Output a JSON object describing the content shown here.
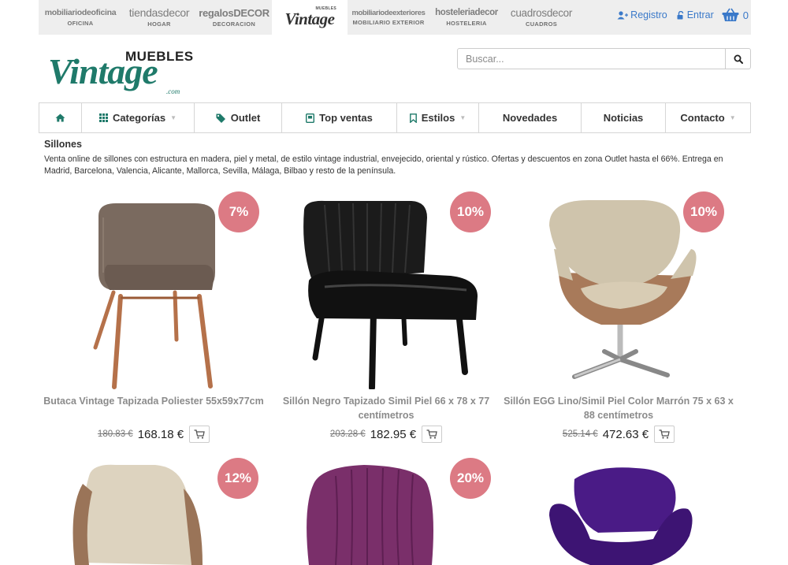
{
  "sites": [
    {
      "name": "mobiliariodeoficina",
      "sub": "OFICINA"
    },
    {
      "name": "tiendasdecor",
      "sub": "HOGAR"
    },
    {
      "name": "regalosDECOR",
      "sub": "DECORACION"
    },
    {
      "name": "Vintage",
      "sub": "MUEBLES",
      "active": true
    },
    {
      "name": "mobiliariodeexteriores",
      "sub": "MOBILIARIO EXTERIOR"
    },
    {
      "name": "hosteleriadecor",
      "sub": "HOSTELERIA"
    },
    {
      "name": "cuadrosdecor",
      "sub": "CUADROS"
    }
  ],
  "account": {
    "register": "Registro",
    "login": "Entrar",
    "cart_count": "0"
  },
  "logo": {
    "muebles": "MUEBLES",
    "vintage": "Vintage",
    "com": ".com"
  },
  "search": {
    "placeholder": "Buscar..."
  },
  "nav": {
    "home_icon": "home-icon",
    "items": [
      {
        "label": "Categorías",
        "icon": "grid-icon",
        "dropdown": true
      },
      {
        "label": "Outlet",
        "icon": "tag-icon",
        "dropdown": false
      },
      {
        "label": "Top ventas",
        "icon": "award-icon",
        "dropdown": false
      },
      {
        "label": "Estilos",
        "icon": "bookmark-icon",
        "dropdown": true
      },
      {
        "label": "Novedades",
        "dropdown": false
      },
      {
        "label": "Noticias",
        "dropdown": false
      },
      {
        "label": "Contacto",
        "dropdown": true
      }
    ]
  },
  "category": {
    "title": "Sillones",
    "description": "Venta online de sillones con estructura en madera, piel y metal, de estilo vintage industrial, envejecido, oriental y rústico. Ofertas y descuentos en zona Outlet hasta el 66%. Entrega en Madrid, Barcelona, Valencia, Alicante, Mallorca, Sevilla, Málaga, Bilbao y resto de la península."
  },
  "products": [
    {
      "name": "Butaca Vintage Tapizada Poliester 55x59x77cm",
      "old_price": "180.83 €",
      "price": "168.18 €",
      "discount": "7%"
    },
    {
      "name": "Sillón Negro Tapizado Simil Piel 66 x 78 x 77 centímetros",
      "old_price": "203.28 €",
      "price": "182.95 €",
      "discount": "10%"
    },
    {
      "name": "Sillón EGG Lino/Simil Piel Color Marrón 75 x 63 x 88 centímetros",
      "old_price": "525.14 €",
      "price": "472.63 €",
      "discount": "10%"
    },
    {
      "name": "",
      "old_price": "",
      "price": "",
      "discount": "12%"
    },
    {
      "name": "",
      "old_price": "",
      "price": "",
      "discount": "20%"
    },
    {
      "name": "",
      "old_price": "",
      "price": "",
      "discount": ""
    }
  ],
  "colors": {
    "accent_link": "#3a79c9",
    "badge": "#dc7a84",
    "logo_green": "#1f7a6a"
  }
}
